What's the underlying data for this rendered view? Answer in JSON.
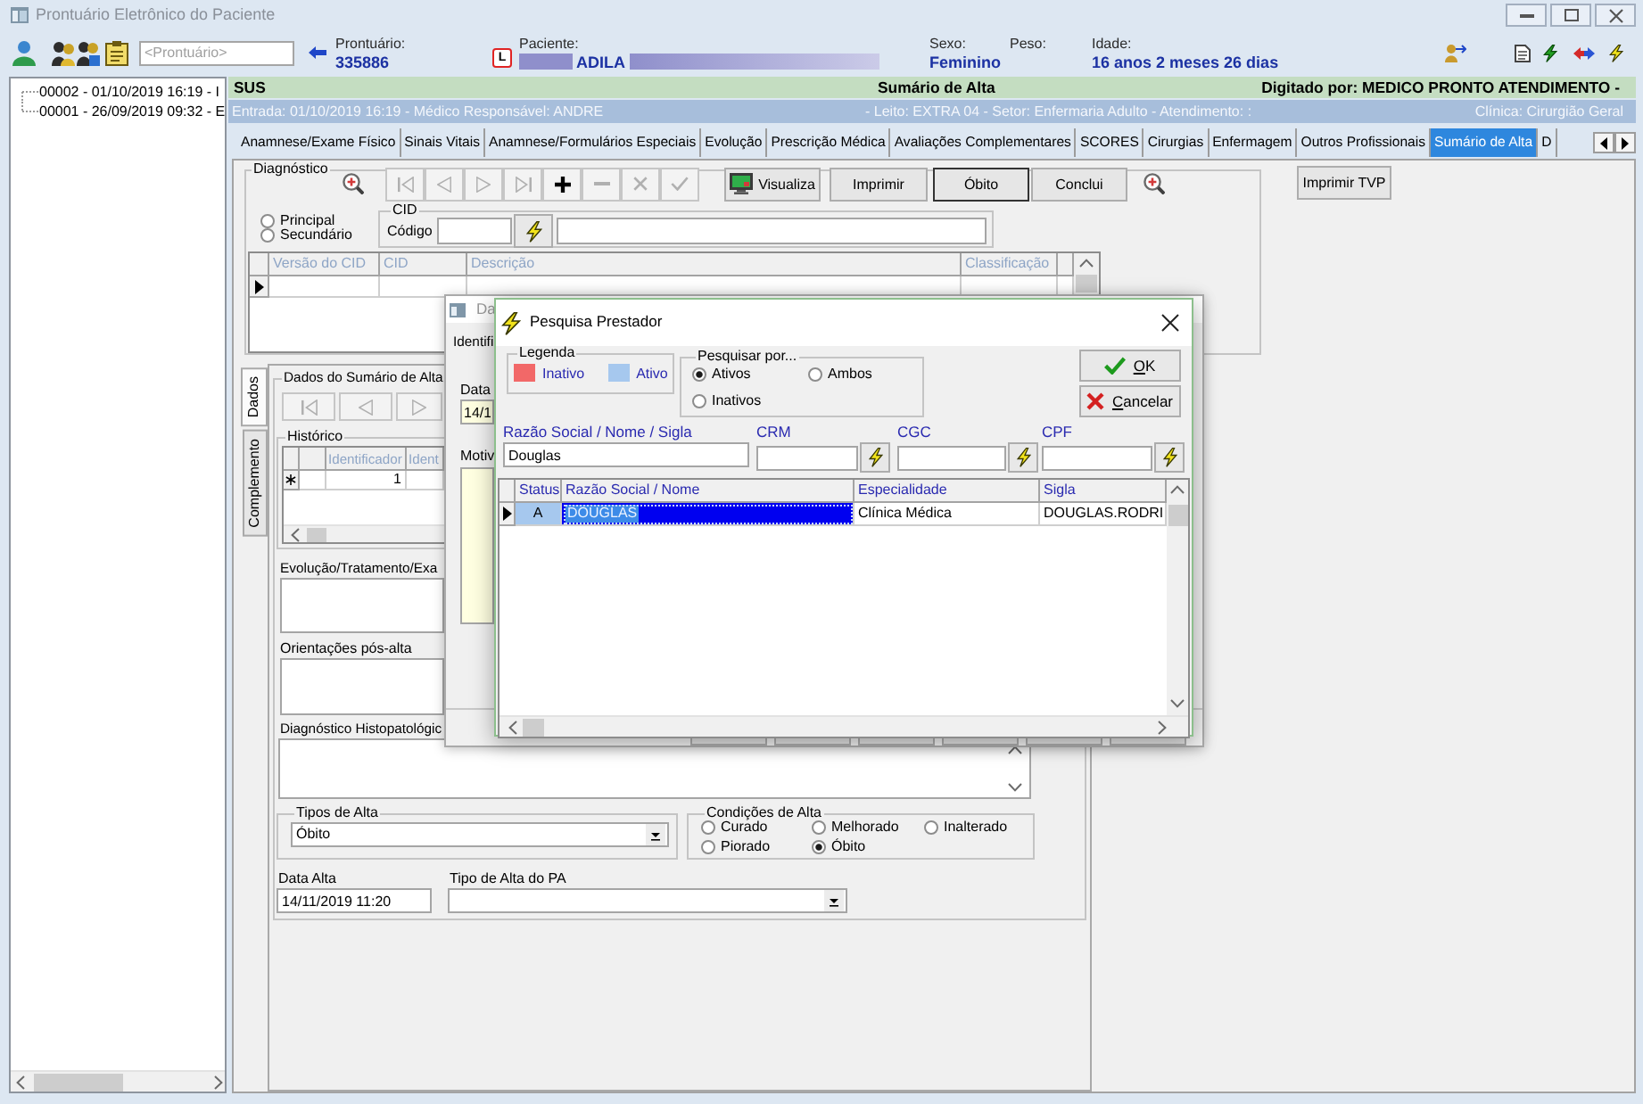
{
  "window": {
    "title": "Prontuário Eletrônico do Paciente"
  },
  "patient_bar": {
    "search": {
      "placeholder": "<Prontuário>"
    },
    "record": {
      "label": "Prontuário:",
      "value": "335886"
    },
    "flag": "L",
    "patient": {
      "label": "Paciente:",
      "value": "ADILA",
      "redacted": true
    },
    "sex": {
      "label": "Sexo:",
      "value": "Feminino"
    },
    "weight": {
      "label": "Peso:"
    },
    "age": {
      "label": "Idade:",
      "value": "16 anos 2 meses 26 dias"
    }
  },
  "history_tree": {
    "items": [
      {
        "label": "00002 - 01/10/2019 16:19 - I"
      },
      {
        "label": "00001 - 26/09/2019 09:32 - E"
      }
    ]
  },
  "header": {
    "insurance": "SUS",
    "title": "Sumário de Alta",
    "typed_by": "Digitado por: MEDICO PRONTO ATENDIMENTO -"
  },
  "info_bar": {
    "admission": "Entrada: 01/10/2019 16:19 - Médico Responsável: ANDRE",
    "location": "- Leito: EXTRA 04 - Setor: Enfermaria Adulto - Atendimento: :",
    "clinic": "Clínica: Cirurgião Geral"
  },
  "tabs": [
    {
      "label": "Anamnese/Exame Físico",
      "selected": false
    },
    {
      "label": "Sinais Vitais",
      "selected": false
    },
    {
      "label": "Anamnese/Formulários Especiais",
      "selected": false
    },
    {
      "label": "Evolução",
      "selected": false
    },
    {
      "label": "Prescrição Médica",
      "selected": false
    },
    {
      "label": "Avaliações Complementares",
      "selected": false
    },
    {
      "label": "SCORES",
      "selected": false
    },
    {
      "label": "Cirurgias",
      "selected": false
    },
    {
      "label": "Enfermagem",
      "selected": false
    },
    {
      "label": "Outros Profissionais",
      "selected": false
    },
    {
      "label": "Sumário de Alta",
      "selected": true
    },
    {
      "label": "D",
      "selected": false
    }
  ],
  "diagnosis": {
    "title": "Diagnóstico",
    "navigator": [
      {
        "kind": "first",
        "disabled": true
      },
      {
        "kind": "prior",
        "disabled": true
      },
      {
        "kind": "next",
        "disabled": true
      },
      {
        "kind": "last",
        "disabled": true
      },
      {
        "kind": "insert",
        "disabled": false
      },
      {
        "kind": "delete",
        "disabled": true
      },
      {
        "kind": "cancel",
        "disabled": true
      },
      {
        "kind": "post",
        "disabled": true
      }
    ],
    "actions": [
      {
        "kind": "preview",
        "label": "Visualiza",
        "default": false
      },
      {
        "kind": "plain",
        "label": "Imprimir",
        "default": false
      },
      {
        "kind": "plain",
        "label": "Óbito",
        "default": true
      },
      {
        "kind": "plain",
        "label": "Conclui",
        "default": false
      }
    ],
    "print_tvp": "Imprimir TVP",
    "cid_type": [
      {
        "label": "Principal",
        "selected": false
      },
      {
        "label": "Secundário",
        "selected": false
      }
    ],
    "cid": {
      "title": "CID",
      "code_label": "Código"
    },
    "grid": {
      "columns": [
        "Versão do CID",
        "CID",
        "Descrição",
        "Classificação"
      ],
      "rows": [
        {
          "selected": true
        }
      ]
    }
  },
  "side_tabs": [
    {
      "label": "Dados",
      "selected": true
    },
    {
      "label": "Complemento",
      "selected": false
    }
  ],
  "summary": {
    "title": "Dados do Sumário de Alta",
    "navigator": [
      {
        "kind": "first",
        "disabled": true
      },
      {
        "kind": "prior",
        "disabled": true
      },
      {
        "kind": "next",
        "disabled": true
      }
    ],
    "history": {
      "title": "Histórico",
      "columns": [
        "Identificador",
        "Ident"
      ],
      "rows": [
        {
          "kind": "new",
          "cells": [
            "1"
          ]
        }
      ]
    },
    "notes": [
      {
        "label": "Evolução/Tratamento/Exa"
      },
      {
        "label": "Orientações pós-alta"
      },
      {
        "label": "Diagnóstico Histopatológic"
      }
    ],
    "discharge_type": {
      "title": "Tipos de Alta",
      "value": "Óbito"
    },
    "conditions": {
      "title": "Condições de Alta",
      "options": [
        {
          "label": "Curado",
          "selected": false
        },
        {
          "label": "Melhorado",
          "selected": false
        },
        {
          "label": "Inalterado",
          "selected": false
        },
        {
          "label": "Piorado",
          "selected": false
        },
        {
          "label": "Óbito",
          "selected": true
        }
      ]
    },
    "discharge_date": {
      "label": "Data Alta",
      "value": "14/11/2019 11:20"
    },
    "pa_type": {
      "label": "Tipo de Alta do PA"
    }
  },
  "record_dialog": {
    "title": "Da",
    "fields": [
      {
        "kind": "label",
        "label": "Identifi"
      },
      {
        "kind": "date",
        "label": "Data",
        "value": "14/1"
      },
      {
        "kind": "memo",
        "label": "Motiv"
      }
    ]
  },
  "search_dialog": {
    "title": "Pesquisa Prestador",
    "legend": {
      "title": "Legenda",
      "items": [
        {
          "label": "Inativo",
          "color": "#f26868"
        },
        {
          "label": "Ativo",
          "color": "#a6c8ee"
        }
      ]
    },
    "search_by": {
      "title": "Pesquisar por...",
      "options": [
        {
          "label": "Ativos",
          "selected": true
        },
        {
          "label": "Ambos",
          "selected": false
        },
        {
          "label": "Inativos",
          "selected": false
        }
      ]
    },
    "buttons": [
      {
        "kind": "ok",
        "label": "OK"
      },
      {
        "kind": "cancel",
        "label": "Cancelar"
      }
    ],
    "filters": [
      {
        "label": "Razão Social / Nome / Sigla",
        "value": "Douglas",
        "lookup": false
      },
      {
        "label": "CRM",
        "lookup": true
      },
      {
        "label": "CGC",
        "lookup": true
      },
      {
        "label": "CPF",
        "lookup": true
      }
    ],
    "grid": {
      "columns": [
        "Status",
        "Razão Social / Nome",
        "Especialidade",
        "Sigla"
      ],
      "rows": [
        {
          "selected": true,
          "color": "#a6c8ee",
          "cells": [
            "A",
            "DOUGLAS",
            "Clínica Médica",
            "DOUGLAS.RODRI"
          ]
        }
      ]
    }
  }
}
